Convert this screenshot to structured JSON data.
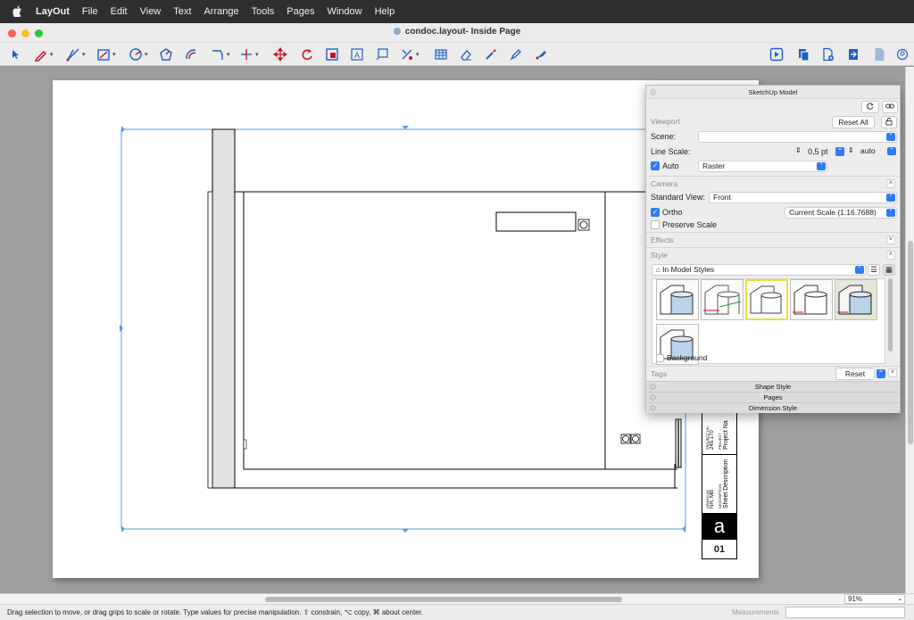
{
  "menubar": {
    "app_name": "LayOut",
    "items": [
      "File",
      "Edit",
      "View",
      "Text",
      "Arrange",
      "Tools",
      "Pages",
      "Window",
      "Help"
    ]
  },
  "window": {
    "title": "condoc.layout- Inside Page"
  },
  "toolbar": {
    "left_tools": [
      "select-tool",
      "pencil-tool",
      "line-tool",
      "rectangle-tool",
      "circle-tool",
      "polygon-tool",
      "offset-tool",
      "dimension-tool",
      "label-tool",
      "move-tool",
      "rotate-tool",
      "scale-tool",
      "text-tool",
      "table-tool",
      "style-tool",
      "eraser-tool",
      "sample-tool",
      "paint-tool",
      "split-tool"
    ],
    "right_tools": [
      "presentation-icon",
      "reference-icon",
      "add-page-icon",
      "export-icon",
      "document-icon",
      "account-icon"
    ]
  },
  "inspector": {
    "title": "SketchUp Model",
    "viewport": {
      "heading": "Viewport",
      "reset_all": "Reset All",
      "scene_label": "Scene:",
      "scene_value": "",
      "line_scale_label": "Line Scale:",
      "line_scale_value": "0,5 pt",
      "line_scale_mode": "auto",
      "auto_label": "Auto",
      "auto_checked": true,
      "render_mode": "Raster"
    },
    "camera": {
      "heading": "Camera",
      "standard_view_label": "Standard View:",
      "standard_view_value": "Front",
      "ortho_label": "Ortho",
      "ortho_checked": true,
      "scale_value": "Current Scale (1:16.7688)",
      "preserve_scale_label": "Preserve Scale",
      "preserve_scale_checked": false
    },
    "effects": {
      "heading": "Effects"
    },
    "style": {
      "heading": "Style",
      "collection": "In Model Styles",
      "background_label": "Background",
      "background_checked": false,
      "selected_index": 2
    },
    "tags": {
      "heading": "Tags",
      "reset_label": "Reset"
    },
    "collapsed_panels": [
      "Shape Style",
      "Pages",
      "Dimension Style"
    ]
  },
  "titleblock": {
    "project_no_label": "PROJECT NO.",
    "project_no": "245.170",
    "project_label": "PROJECT",
    "project_name": "Project Na",
    "drawn_by_label": "DRAWN BY",
    "drawn_by": "NH, MB",
    "description_label": "DESCRIPTION",
    "description": "Sheet Description",
    "logo_letter": "a",
    "sheet_number": "01"
  },
  "statusbar": {
    "hint": "Drag selection to move, or drag grips to scale or rotate. Type values for precise manipulation. ⇧ constrain, ⌥ copy, ⌘ about center.",
    "measurements_label": "Measurements",
    "measurements_value": "",
    "zoom": "91%"
  }
}
